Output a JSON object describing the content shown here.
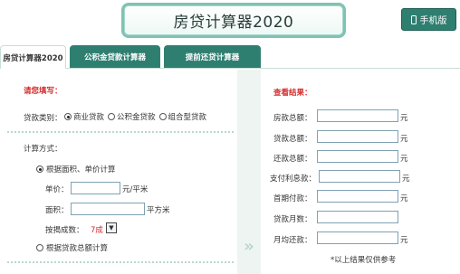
{
  "header": {
    "title": "房贷计算器2020",
    "mobile_label": "手机版"
  },
  "tabs": [
    {
      "label": "房贷计算器2020"
    },
    {
      "label": "公积金贷款计算器"
    },
    {
      "label": "提前还贷计算器"
    }
  ],
  "left": {
    "fill_title": "请您填写：",
    "loan_type_label": "贷款类别：",
    "loan_types": [
      "商业贷款",
      "公积金贷款",
      "组合型贷款"
    ],
    "calc_mode_label": "计算方式：",
    "mode_area": "根据面积、单价计算",
    "unit_price_label": "单价：",
    "unit_price_unit": "元/平米",
    "area_label": "面积：",
    "area_unit": "平方米",
    "ratio_label": "按揭成数：",
    "ratio_value": "7成",
    "mode_total": "根据贷款总额计算"
  },
  "right": {
    "result_title": "查看结果：",
    "rows": [
      {
        "label": "房款总额：",
        "unit": "元"
      },
      {
        "label": "贷款总额：",
        "unit": "元"
      },
      {
        "label": "还款总额：",
        "unit": "元"
      },
      {
        "label": "支付利息款：",
        "unit": "元"
      },
      {
        "label": "首期付款：",
        "unit": "元"
      },
      {
        "label": "贷款月数：",
        "unit": ""
      },
      {
        "label": "月均还款：",
        "unit": "元"
      }
    ],
    "note": "*以上结果仅供参考"
  },
  "colors": {
    "accent": "#2f7f71",
    "warning": "#d42a2a"
  }
}
